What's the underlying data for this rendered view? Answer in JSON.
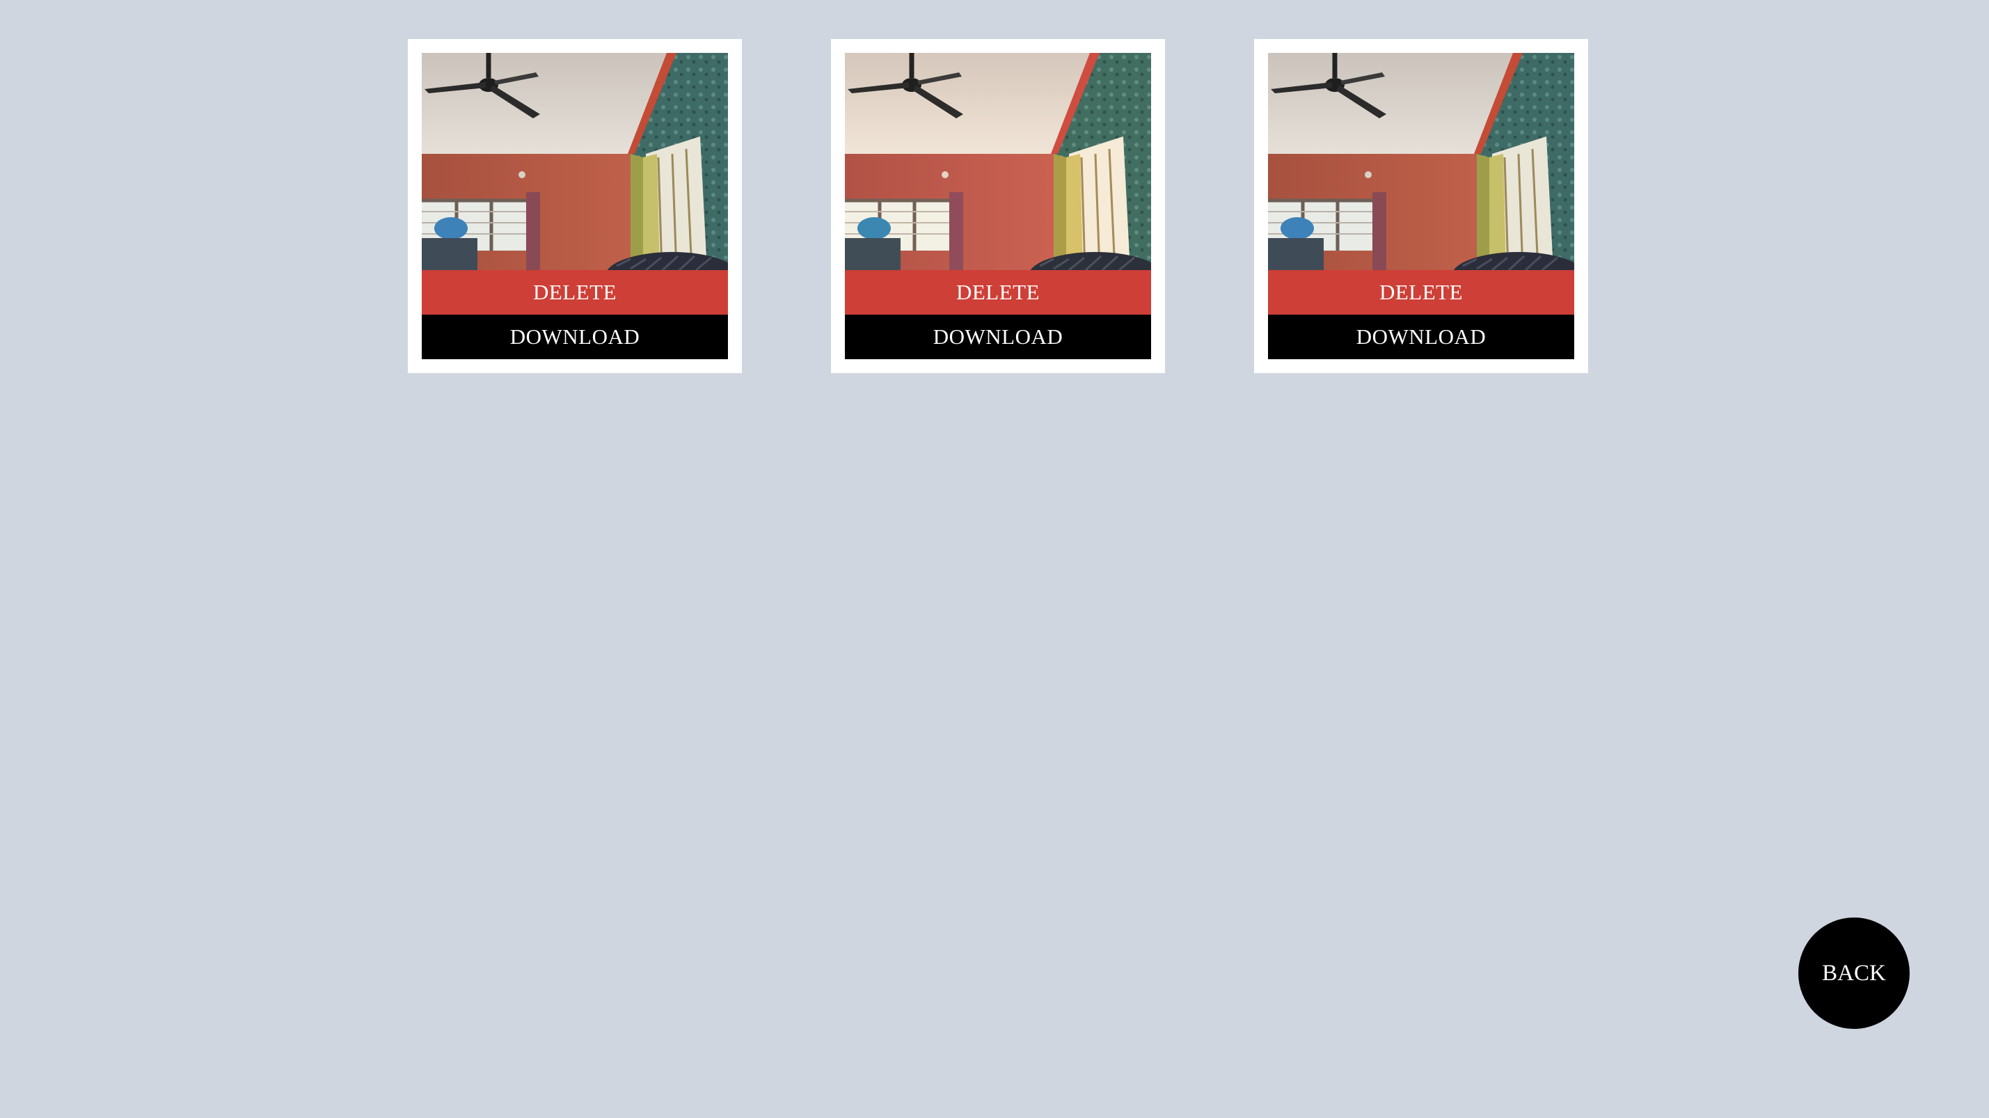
{
  "gallery": {
    "photos": [
      {
        "delete_label": "DELETE",
        "download_label": "DOWNLOAD"
      },
      {
        "delete_label": "DELETE",
        "download_label": "DOWNLOAD"
      },
      {
        "delete_label": "DELETE",
        "download_label": "DOWNLOAD"
      }
    ]
  },
  "back_button": {
    "label": "BACK"
  },
  "colors": {
    "background": "#cfd6e0",
    "card": "#ffffff",
    "delete": "#cd3f37",
    "download": "#000000",
    "back": "#000000"
  }
}
